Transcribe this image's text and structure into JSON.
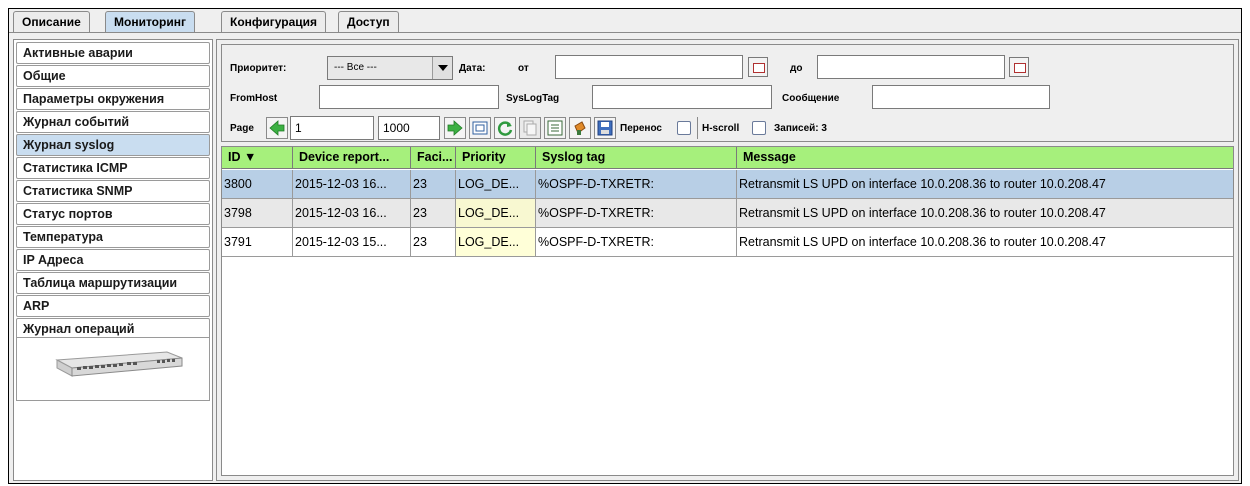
{
  "top_tabs": [
    {
      "label": "Описание",
      "active": false
    },
    {
      "label": "Мониторинг",
      "active": true
    },
    {
      "label": "Конфигурация",
      "active": false
    },
    {
      "label": "Доступ",
      "active": false
    }
  ],
  "sidebar": {
    "items": [
      {
        "label": "Активные аварии"
      },
      {
        "label": "Общие"
      },
      {
        "label": "Параметры окружения"
      },
      {
        "label": "Журнал событий"
      },
      {
        "label": "Журнал syslog",
        "active": true
      },
      {
        "label": "Статистика ICMP"
      },
      {
        "label": "Статистика SNMP"
      },
      {
        "label": "Статус портов"
      },
      {
        "label": "Температура"
      },
      {
        "label": "IP Адреса"
      },
      {
        "label": "Таблица маршрутизации"
      },
      {
        "label": "ARP"
      },
      {
        "label": "Журнал операций"
      }
    ]
  },
  "filters": {
    "priority_label": "Приоритет:",
    "priority_value": "--- Все ---",
    "date_label": "Дата:",
    "from_label": "от",
    "from_value": "",
    "to_label": "до",
    "to_value": "",
    "fromhost_label": "FromHost",
    "fromhost_value": "",
    "syslogtag_label": "SysLogTag",
    "syslogtag_value": "",
    "message_label": "Сообщение",
    "message_value": ""
  },
  "toolbar": {
    "page_label": "Page",
    "page_value": "1",
    "page_size": "1000",
    "wrap_label": "Перенос",
    "hscroll_label": "H-scroll",
    "records_label": "Записей: 3"
  },
  "table": {
    "columns": [
      "ID ▼",
      "Device report...",
      "Faci...",
      "Priority",
      "Syslog tag",
      "Message"
    ],
    "rows": [
      [
        "3800",
        "2015-12-03 16...",
        "23",
        "LOG_DE...",
        "%OSPF-D-TXRETR:",
        "Retransmit LS UPD on interface 10.0.208.36 to router 10.0.208.47"
      ],
      [
        "3798",
        "2015-12-03 16...",
        "23",
        "LOG_DE...",
        "%OSPF-D-TXRETR:",
        "Retransmit LS UPD on interface 10.0.208.36 to router 10.0.208.47"
      ],
      [
        "3791",
        "2015-12-03 15...",
        "23",
        "LOG_DE...",
        "%OSPF-D-TXRETR:",
        "Retransmit LS UPD on interface 10.0.208.36 to router 10.0.208.47"
      ]
    ]
  },
  "colors": {
    "header_green": "#a6f07c",
    "selected_row": "#b8cfe6",
    "active_tab": "#c9ddf0"
  },
  "icons": [
    "back-arrow-icon",
    "forward-arrow-icon",
    "fit-icon",
    "refresh-icon",
    "copy-icon",
    "list-icon",
    "clean-icon",
    "save-icon",
    "calendar-icon",
    "device-image"
  ]
}
